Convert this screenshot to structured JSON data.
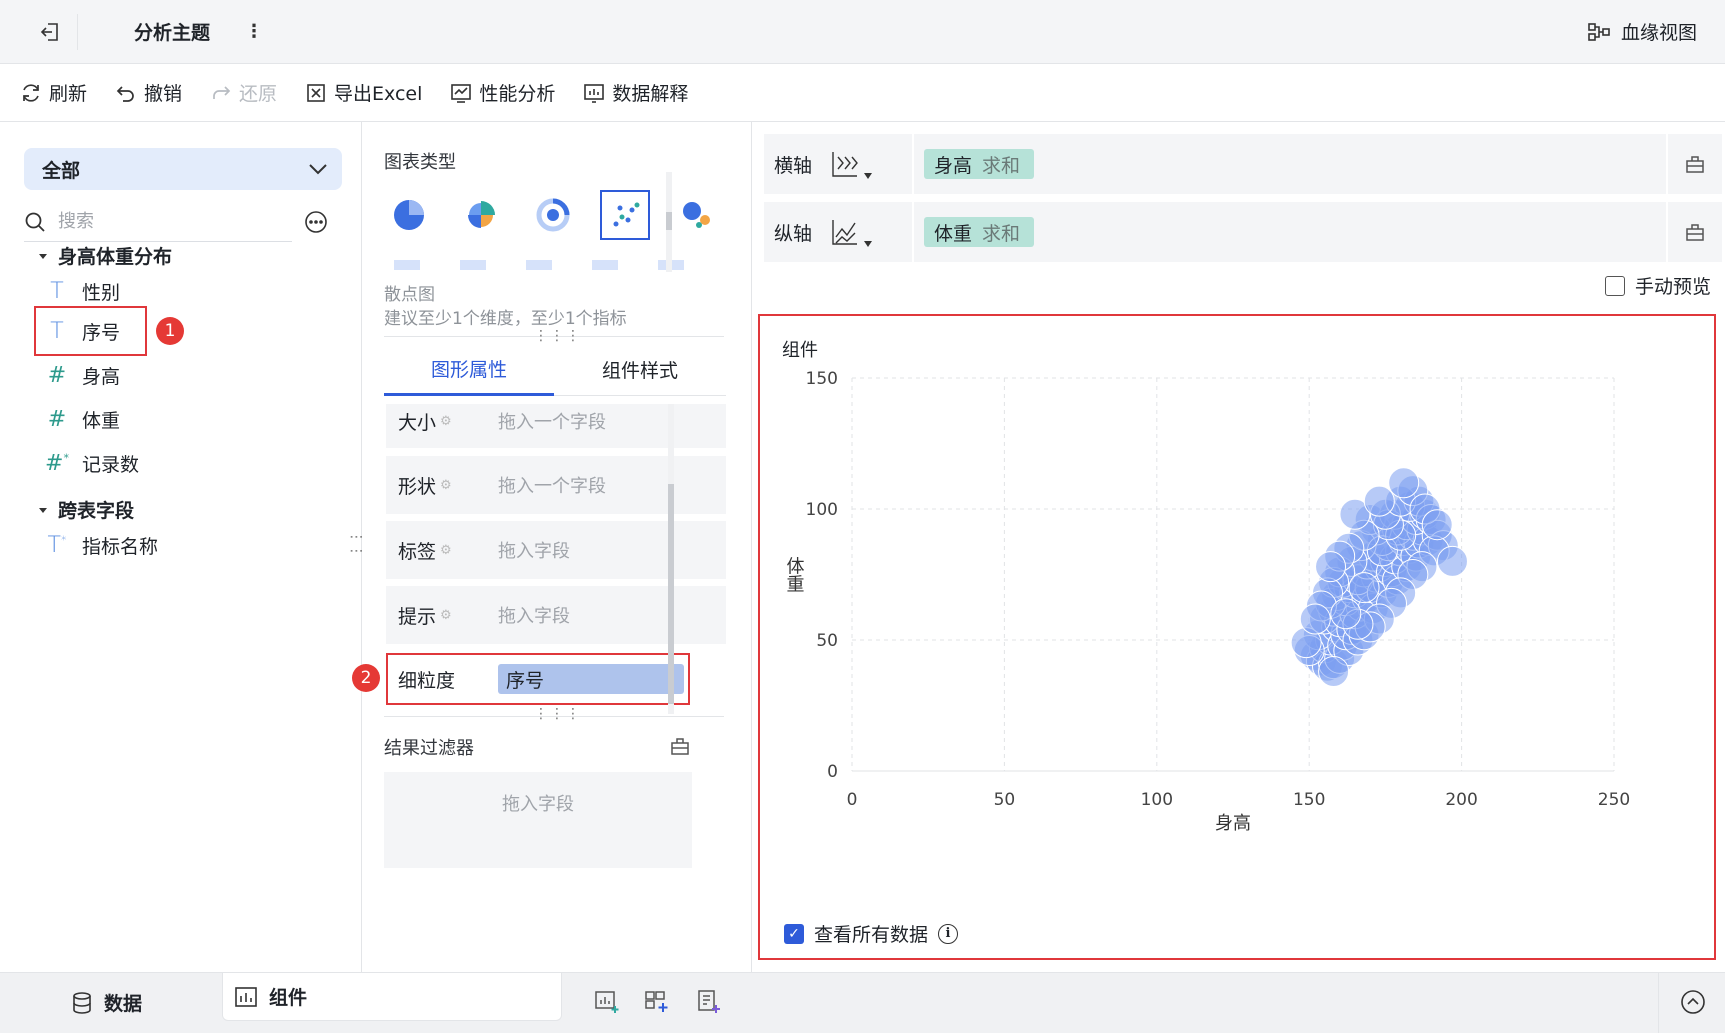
{
  "titlebar": {
    "title": "分析主题",
    "lineage_label": "血缘视图"
  },
  "toolbar": {
    "refresh": "刷新",
    "undo": "撤销",
    "redo": "还原",
    "export_excel": "导出Excel",
    "performance": "性能分析",
    "data_explain": "数据解释"
  },
  "left": {
    "scope": "全部",
    "search_placeholder": "搜索",
    "groups": [
      {
        "name": "身高体重分布"
      },
      {
        "name": "跨表字段"
      }
    ],
    "fields": [
      {
        "label": "性别",
        "kind": "T"
      },
      {
        "label": "序号",
        "kind": "T",
        "badge": "1"
      },
      {
        "label": "身高",
        "kind": "#"
      },
      {
        "label": "体重",
        "kind": "#"
      },
      {
        "label": "记录数",
        "kind": "#*"
      }
    ],
    "cross_fields": [
      {
        "label": "指标名称",
        "kind": "T*"
      }
    ]
  },
  "middle": {
    "chart_type_label": "图表类型",
    "selected_chart_name": "散点图",
    "selected_chart_hint": "建议至少1个维度，至少1个指标",
    "tabs": [
      "图形属性",
      "组件样式"
    ],
    "props": [
      {
        "name": "大小",
        "drop": "拖入一个字段"
      },
      {
        "name": "形状",
        "drop": "拖入一个字段"
      },
      {
        "name": "标签",
        "drop": "拖入字段"
      },
      {
        "name": "提示",
        "drop": "拖入字段"
      }
    ],
    "granularity": {
      "name": "细粒度",
      "value": "序号",
      "badge": "2"
    },
    "filter_label": "结果过滤器",
    "filter_drop": "拖入字段"
  },
  "right": {
    "x_axis_label": "横轴",
    "x_field": "身高",
    "x_agg": "求和",
    "y_axis_label": "纵轴",
    "y_field": "体重",
    "y_agg": "求和",
    "manual_preview": "手动预览",
    "component_title": "组件",
    "view_all_data": "查看所有数据"
  },
  "chart_data": {
    "type": "scatter",
    "xlabel": "身高",
    "ylabel": "体重",
    "xlim": [
      0,
      250
    ],
    "ylim": [
      0,
      150
    ],
    "xticks": [
      "0",
      "50",
      "100",
      "150",
      "200",
      "250"
    ],
    "yticks": [
      "0",
      "50",
      "100",
      "150"
    ],
    "grid": true,
    "color": "#7b9ff0",
    "points": [
      [
        152,
        44
      ],
      [
        154,
        42
      ],
      [
        156,
        40
      ],
      [
        155,
        47
      ],
      [
        158,
        41
      ],
      [
        160,
        43
      ],
      [
        157,
        50
      ],
      [
        153,
        52
      ],
      [
        150,
        46
      ],
      [
        149,
        49
      ],
      [
        159,
        55
      ],
      [
        161,
        48
      ],
      [
        163,
        46
      ],
      [
        162,
        52
      ],
      [
        155,
        58
      ],
      [
        158,
        61
      ],
      [
        160,
        57
      ],
      [
        164,
        54
      ],
      [
        166,
        50
      ],
      [
        168,
        52
      ],
      [
        165,
        60
      ],
      [
        167,
        63
      ],
      [
        162,
        65
      ],
      [
        159,
        67
      ],
      [
        157,
        64
      ],
      [
        163,
        70
      ],
      [
        161,
        72
      ],
      [
        165,
        68
      ],
      [
        169,
        66
      ],
      [
        171,
        62
      ],
      [
        170,
        70
      ],
      [
        172,
        74
      ],
      [
        168,
        76
      ],
      [
        166,
        73
      ],
      [
        174,
        68
      ],
      [
        176,
        72
      ],
      [
        173,
        78
      ],
      [
        175,
        80
      ],
      [
        171,
        82
      ],
      [
        169,
        79
      ],
      [
        177,
        76
      ],
      [
        179,
        73
      ],
      [
        178,
        81
      ],
      [
        180,
        84
      ],
      [
        182,
        78
      ],
      [
        176,
        86
      ],
      [
        174,
        88
      ],
      [
        181,
        88
      ],
      [
        183,
        85
      ],
      [
        185,
        82
      ],
      [
        184,
        90
      ],
      [
        186,
        87
      ],
      [
        179,
        92
      ],
      [
        182,
        94
      ],
      [
        187,
        92
      ],
      [
        189,
        88
      ],
      [
        185,
        96
      ],
      [
        188,
        98
      ],
      [
        172,
        92
      ],
      [
        167,
        86
      ],
      [
        164,
        80
      ],
      [
        160,
        76
      ],
      [
        158,
        72
      ],
      [
        156,
        68
      ],
      [
        154,
        63
      ],
      [
        170,
        96
      ],
      [
        178,
        98
      ],
      [
        183,
        101
      ],
      [
        186,
        103
      ],
      [
        190,
        96
      ],
      [
        192,
        90
      ],
      [
        194,
        86
      ],
      [
        191,
        84
      ],
      [
        187,
        78
      ],
      [
        184,
        75
      ],
      [
        180,
        68
      ],
      [
        177,
        64
      ],
      [
        173,
        58
      ],
      [
        170,
        55
      ],
      [
        166,
        56
      ],
      [
        162,
        60
      ],
      [
        168,
        70
      ],
      [
        174,
        84
      ],
      [
        180,
        90
      ],
      [
        176,
        94
      ],
      [
        168,
        90
      ],
      [
        163,
        85
      ],
      [
        160,
        82
      ],
      [
        157,
        78
      ],
      [
        152,
        58
      ],
      [
        165,
        98
      ],
      [
        175,
        98
      ],
      [
        180,
        103
      ],
      [
        173,
        103
      ],
      [
        184,
        107
      ],
      [
        188,
        100
      ],
      [
        192,
        94
      ],
      [
        197,
        80
      ],
      [
        181,
        110
      ],
      [
        158,
        38
      ]
    ]
  }
}
